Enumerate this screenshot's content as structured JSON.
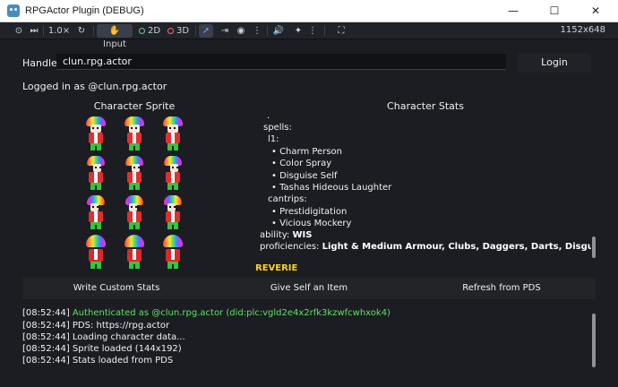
{
  "window": {
    "title": "RPGActor Plugin (DEBUG)",
    "minimize": "—",
    "maximize": "☐",
    "close": "✕"
  },
  "toolbar": {
    "speed": "1.0×",
    "input_label": "Input",
    "mode_2d": "2D",
    "mode_3d": "3D",
    "resolution": "1152x648"
  },
  "handle": {
    "label": "Handle:",
    "value": "clun.rpg.actor"
  },
  "login_button": "Login",
  "status": "Logged in as @clun.rpg.actor",
  "sprite_panel": {
    "title": "Character Sprite"
  },
  "stats_panel": {
    "title": "Character Stats",
    "lines": [
      ".",
      "spells:",
      "l1:",
      "• Charm Person",
      "• Color Spray",
      "• Disguise Self",
      "• Tashas Hideous Laughter",
      "cantrips:",
      "• Prestidigitation",
      "• Vicious Mockery"
    ],
    "ability_key": "ability:",
    "ability_value": "WIS",
    "proficiencies_key": "proficiencies:",
    "proficiencies_value": "Light & Medium Armour, Clubs, Daggers, Darts, Disguise Kit",
    "section_heading": "REVERIE"
  },
  "actions": {
    "write_stats": "Write Custom Stats",
    "give_item": "Give Self an Item",
    "refresh": "Refresh from PDS"
  },
  "log": [
    {
      "time": "[08:52:44]",
      "text": "Authenticated as @clun.rpg.actor (did:plc:vgld2e4x2rfk3kzwfcwhxok4)",
      "highlight": true
    },
    {
      "time": "[08:52:44]",
      "text": "PDS: https://rpg.actor",
      "highlight": false
    },
    {
      "time": "[08:52:44]",
      "text": "Loading character data...",
      "highlight": false
    },
    {
      "time": "[08:52:44]",
      "text": "Sprite loaded (144x192)",
      "highlight": false
    },
    {
      "time": "[08:52:44]",
      "text": "Stats loaded from PDS",
      "highlight": false
    }
  ],
  "colors": {
    "background": "#1b1d23",
    "log_highlight": "#5ee060",
    "heading_accent": "#ffd21f",
    "active_tool": "#6ea8ff"
  }
}
